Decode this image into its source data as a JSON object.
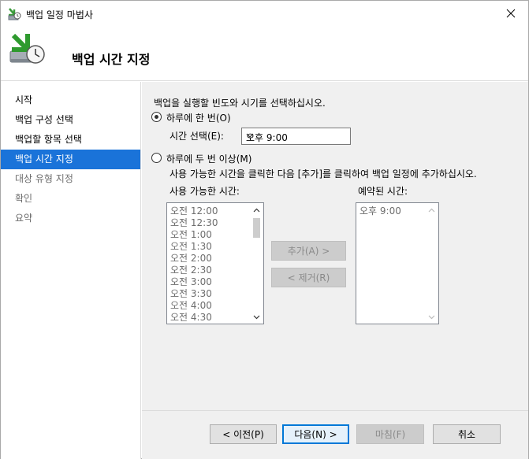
{
  "window": {
    "title": "백업 일정 마법사"
  },
  "header": {
    "title": "백업 시간 지정"
  },
  "sidebar": {
    "items": [
      {
        "label": "시작",
        "state": "normal"
      },
      {
        "label": "백업 구성 선택",
        "state": "normal"
      },
      {
        "label": "백업할 항목 선택",
        "state": "normal"
      },
      {
        "label": "백업 시간 지정",
        "state": "active"
      },
      {
        "label": "대상 유형 지정",
        "state": "dim"
      },
      {
        "label": "확인",
        "state": "dim"
      },
      {
        "label": "요약",
        "state": "dim"
      }
    ]
  },
  "main": {
    "instruction": "백업을 실행할 빈도와 시기를 선택하십시오.",
    "once_daily": {
      "label": "하루에 한 번(O)",
      "checked": true
    },
    "time_select": {
      "label": "시간 선택(E):",
      "value": "오후 9:00"
    },
    "multiple_daily": {
      "label": "하루에 두 번 이상(M)",
      "checked": false
    },
    "multiple_hint": "사용 가능한 시간을 클릭한 다음 [추가]를 클릭하여 백업 일정에 추가하십시오.",
    "available_label": "사용 가능한 시간:",
    "scheduled_label": "예약된 시간:",
    "available_times": [
      "오전 12:00",
      "오전 12:30",
      "오전 1:00",
      "오전 1:30",
      "오전 2:00",
      "오전 2:30",
      "오전 3:00",
      "오전 3:30",
      "오전 4:00",
      "오전 4:30"
    ],
    "scheduled_times": [
      "오후 9:00"
    ],
    "add_button": "추가(A) >",
    "remove_button": "< 제거(R)"
  },
  "footer": {
    "prev_button": "< 이전(P)",
    "next_button": "다음(N) >",
    "finish_button": "마침(F)",
    "cancel_button": "취소"
  },
  "colors": {
    "accent": "#1a73d9",
    "panel": "#f0f0f0",
    "primary_border": "#0078d7"
  },
  "icons": {
    "title": "backup-wizard-icon",
    "header": "backup-clock-icon",
    "close": "close-icon"
  }
}
